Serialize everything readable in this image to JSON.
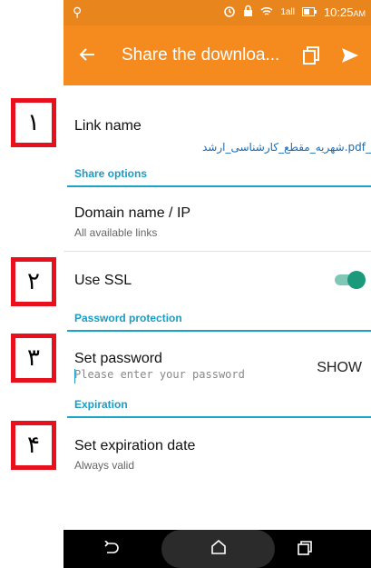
{
  "markers": [
    "١",
    "٢",
    "٣",
    "۴"
  ],
  "status": {
    "time": "10:25",
    "ampm": "AM",
    "net": "1all"
  },
  "appbar": {
    "title": "Share the downloa..."
  },
  "link": {
    "title": "Link name",
    "filename": "شهریه_مقطع_کارشناسی_ارشد.pdf_"
  },
  "sections": {
    "share": "Share options",
    "password": "Password protection",
    "expiration": "Expiration"
  },
  "domain": {
    "title": "Domain name / IP",
    "sub": "All available links"
  },
  "ssl": {
    "title": "Use SSL",
    "enabled": true
  },
  "password": {
    "title": "Set password",
    "placeholder": "Please enter your password",
    "show": "SHOW"
  },
  "expiry": {
    "title": "Set expiration date",
    "sub": "Always valid"
  },
  "colors": {
    "accent": "#f58a1f",
    "section": "#1a9cc4",
    "marker": "#e8101c",
    "toggle": "#1a9a7a"
  },
  "icons": [
    "usb-icon",
    "alarm-icon",
    "lock-icon",
    "wifi-icon",
    "signal-icon",
    "battery-icon",
    "back-arrow-icon",
    "copy-icon",
    "send-icon",
    "nav-back-icon",
    "nav-home-icon",
    "nav-recent-icon"
  ]
}
